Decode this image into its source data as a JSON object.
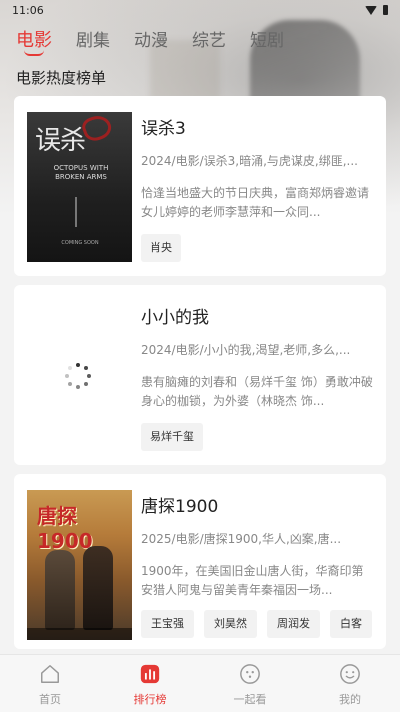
{
  "status_bar": {
    "time": "11:06"
  },
  "tabs": [
    {
      "label": "电影",
      "active": true
    },
    {
      "label": "剧集",
      "active": false
    },
    {
      "label": "动漫",
      "active": false
    },
    {
      "label": "综艺",
      "active": false
    },
    {
      "label": "短剧",
      "active": false
    }
  ],
  "section_title": "电影热度榜单",
  "movies": [
    {
      "title": "误杀3",
      "meta": "2024/电影/误杀3,暗涌,与虎谋皮,绑匪,...",
      "description": "恰逢当地盛大的节日庆典，富商郑炳睿邀请女儿婷婷的老师李慧萍和一众同...",
      "cast": [
        "肖央"
      ],
      "poster_title": "误杀",
      "poster_subtitle": "OCTOPUS WITH BROKEN ARMS",
      "poster_footer": "COMING SOON"
    },
    {
      "title": "小小的我",
      "meta": "2024/电影/小小的我,渴望,老师,多么,...",
      "description": "患有脑瘫的刘春和（易烊千玺 饰）勇敢冲破身心的枷锁，为外婆（林晓杰 饰...",
      "cast": [
        "易烊千玺"
      ]
    },
    {
      "title": "唐探1900",
      "meta": "2025/电影/唐探1900,华人,凶案,唐...",
      "description": "1900年，在美国旧金山唐人街，华裔印第安猎人阿鬼与留美青年秦福因一场...",
      "cast": [
        "王宝强",
        "刘昊然",
        "周润发",
        "白客"
      ],
      "poster_title": "唐探1900"
    }
  ],
  "bottom_nav": [
    {
      "label": "首页",
      "icon": "home-icon",
      "active": false
    },
    {
      "label": "排行榜",
      "icon": "chart-icon",
      "active": true
    },
    {
      "label": "一起看",
      "icon": "watch-together-icon",
      "active": false
    },
    {
      "label": "我的",
      "icon": "profile-icon",
      "active": false
    }
  ],
  "colors": {
    "accent": "#e53935",
    "background": "#f3f3f3"
  }
}
